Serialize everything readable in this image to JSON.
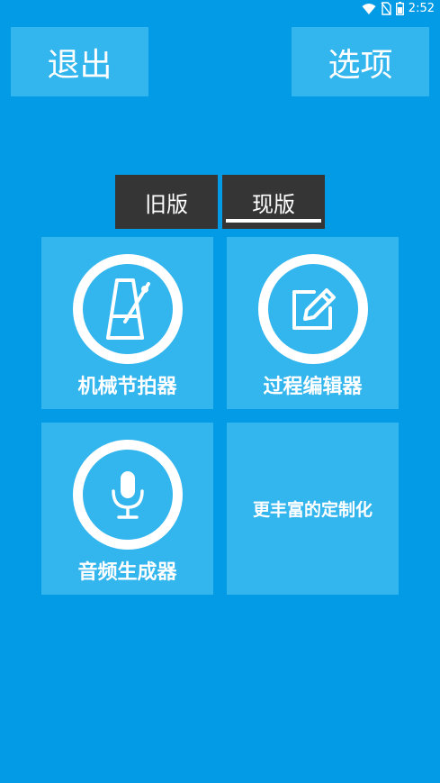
{
  "status_bar": {
    "time": "2:52",
    "icons": [
      "wifi-icon",
      "no-sim-icon",
      "battery-icon"
    ]
  },
  "header": {
    "exit_label": "退出",
    "options_label": "选项"
  },
  "tabs": [
    {
      "label": "旧版",
      "selected": false
    },
    {
      "label": "现版",
      "selected": true
    }
  ],
  "tiles": [
    {
      "label": "机械节拍器",
      "icon": "metronome-icon"
    },
    {
      "label": "过程编辑器",
      "icon": "edit-icon"
    },
    {
      "label": "音频生成器",
      "icon": "microphone-icon"
    },
    {
      "label": "更丰富的定制化",
      "icon": ""
    }
  ],
  "colors": {
    "background": "#039be5",
    "tile": "#33b5ee",
    "tab": "#353535",
    "text": "#ffffff"
  }
}
